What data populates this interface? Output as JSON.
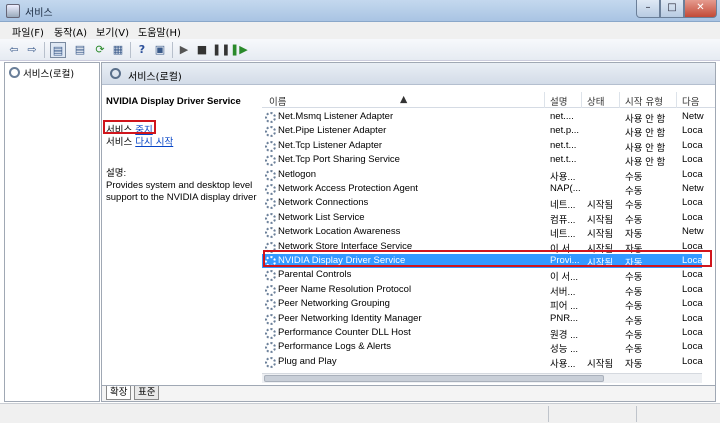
{
  "window": {
    "title": "서비스"
  },
  "menu": [
    "파일(F)",
    "동작(A)",
    "보기(V)",
    "도움말(H)"
  ],
  "tree": {
    "root": "서비스(로컬)"
  },
  "panel": {
    "header": "서비스(로컬)"
  },
  "details": {
    "service_name": "NVIDIA Display Driver Service",
    "action1_prefix": "서비스",
    "action1_link": "중지",
    "action2_prefix": "서비스",
    "action2_link": "다시 시작",
    "desc_label": "설명:",
    "desc_text": "Provides system and desktop level support to the NVIDIA display driver"
  },
  "columns": [
    "이름",
    "설명",
    "상태",
    "시작 유형",
    "다음"
  ],
  "rows": [
    {
      "name": "Net.Msmq Listener Adapter",
      "desc": "net....",
      "status": "",
      "startup": "사용 안 함",
      "logon": "Netw"
    },
    {
      "name": "Net.Pipe Listener Adapter",
      "desc": "net.p...",
      "status": "",
      "startup": "사용 안 함",
      "logon": "Loca"
    },
    {
      "name": "Net.Tcp Listener Adapter",
      "desc": "net.t...",
      "status": "",
      "startup": "사용 안 함",
      "logon": "Loca"
    },
    {
      "name": "Net.Tcp Port Sharing Service",
      "desc": "net.t...",
      "status": "",
      "startup": "사용 안 함",
      "logon": "Loca"
    },
    {
      "name": "Netlogon",
      "desc": "사용...",
      "status": "",
      "startup": "수동",
      "logon": "Loca"
    },
    {
      "name": "Network Access Protection Agent",
      "desc": "NAP(...",
      "status": "",
      "startup": "수동",
      "logon": "Netw"
    },
    {
      "name": "Network Connections",
      "desc": "네트...",
      "status": "시작됨",
      "startup": "수동",
      "logon": "Loca"
    },
    {
      "name": "Network List Service",
      "desc": "컴퓨...",
      "status": "시작됨",
      "startup": "수동",
      "logon": "Loca"
    },
    {
      "name": "Network Location Awareness",
      "desc": "네트...",
      "status": "시작됨",
      "startup": "자동",
      "logon": "Netw"
    },
    {
      "name": "Network Store Interface Service",
      "desc": "이 서...",
      "status": "시작됨",
      "startup": "자동",
      "logon": "Loca"
    },
    {
      "name": "NVIDIA Display Driver Service",
      "desc": "Provi...",
      "status": "시작됨",
      "startup": "자동",
      "logon": "Loca"
    },
    {
      "name": "Parental Controls",
      "desc": "이 서...",
      "status": "",
      "startup": "수동",
      "logon": "Loca"
    },
    {
      "name": "Peer Name Resolution Protocol",
      "desc": "서버...",
      "status": "",
      "startup": "수동",
      "logon": "Loca"
    },
    {
      "name": "Peer Networking Grouping",
      "desc": "피어 ...",
      "status": "",
      "startup": "수동",
      "logon": "Loca"
    },
    {
      "name": "Peer Networking Identity Manager",
      "desc": "PNR...",
      "status": "",
      "startup": "수동",
      "logon": "Loca"
    },
    {
      "name": "Performance Counter DLL Host",
      "desc": "원경 ...",
      "status": "",
      "startup": "수동",
      "logon": "Loca"
    },
    {
      "name": "Performance Logs & Alerts",
      "desc": "성능 ...",
      "status": "",
      "startup": "수동",
      "logon": "Loca"
    },
    {
      "name": "Plug and Play",
      "desc": "사용...",
      "status": "시작됨",
      "startup": "자동",
      "logon": "Loca"
    }
  ],
  "selected_row": 10,
  "tabs": [
    "확장",
    "표준"
  ],
  "colors": {
    "selection": "#3399ff",
    "highlight_box": "#d0151c",
    "link": "#0645c6"
  }
}
